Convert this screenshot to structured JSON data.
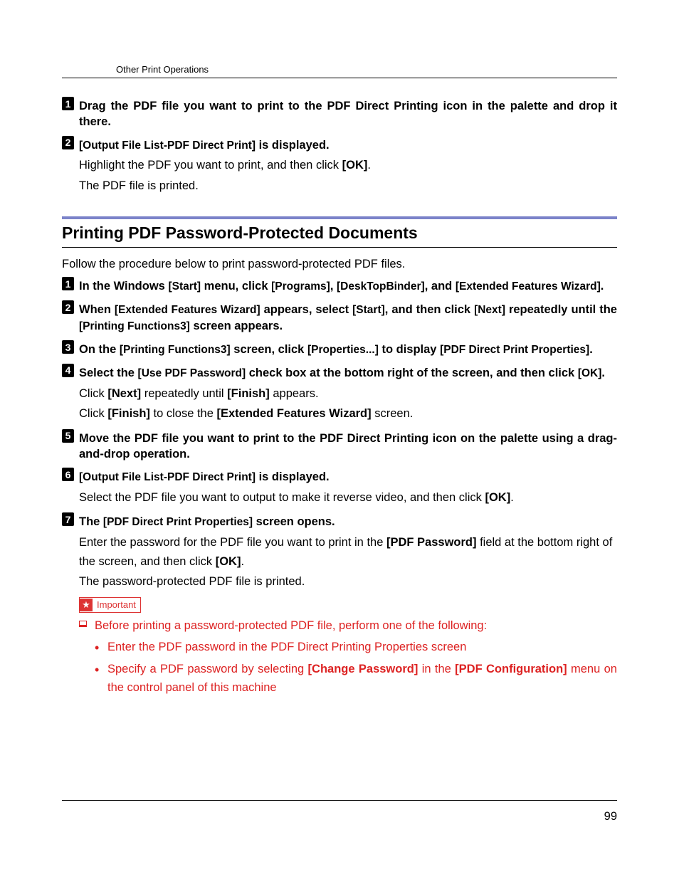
{
  "running_head": "Other Print Operations",
  "page_number": "99",
  "top_steps": {
    "s1": {
      "num": "1",
      "head": "Drag the PDF file you want to print to the PDF Direct Printing icon in the palette and drop it there."
    },
    "s2": {
      "num": "2",
      "head_pre": "[Output File List-PDF Direct Print]",
      "head_post": " is displayed.",
      "body_l1a": "Highlight the PDF you want to print, and then click ",
      "body_l1b": "[OK]",
      "body_l1c": ".",
      "body_l2": "The PDF file is printed."
    }
  },
  "section_title": "Printing PDF Password-Protected Documents",
  "intro": "Follow the procedure below to print password-protected PDF files.",
  "steps": {
    "s1": {
      "num": "1",
      "p1": "In the Windows ",
      "b1": "[Start]",
      "p2": " menu, click ",
      "b2": "[Programs]",
      "p3": ", ",
      "b3": "[DeskTopBinder]",
      "p4": ", and ",
      "b4": "[Extended Features Wizard]",
      "p5": "."
    },
    "s2": {
      "num": "2",
      "p1": "When ",
      "b1": "[Extended Features Wizard]",
      "p2": " appears, select ",
      "b2": "[Start]",
      "p3": ", and then click ",
      "b3": "[Next]",
      "p4": " repeatedly until the ",
      "b4": "[Printing Functions3]",
      "p5": " screen appears."
    },
    "s3": {
      "num": "3",
      "p1": "On the ",
      "b1": "[Printing Functions3]",
      "p2": " screen, click ",
      "b2": "[Properties...]",
      "p3": " to display ",
      "b3": "[PDF Direct Print Properties]",
      "p4": "."
    },
    "s4": {
      "num": "4",
      "p1": "Select the ",
      "b1": "[Use PDF Password]",
      "p2": " check box at the bottom right of the screen, and then click ",
      "b2": "[OK]",
      "p3": ".",
      "body_l1a": "Click ",
      "body_l1b": "[Next]",
      "body_l1c": " repeatedly until ",
      "body_l1d": "[Finish]",
      "body_l1e": " appears.",
      "body_l2a": "Click ",
      "body_l2b": "[Finish]",
      "body_l2c": " to close the ",
      "body_l2d": "[Extended Features Wizard]",
      "body_l2e": " screen."
    },
    "s5": {
      "num": "5",
      "head": "Move the PDF file you want to print to the PDF Direct Printing icon on the palette using a drag-and-drop operation."
    },
    "s6": {
      "num": "6",
      "b1": "[Output File List-PDF Direct Print]",
      "p1": " is displayed.",
      "body_a": "Select the PDF file you want to output to make it reverse video, and then click ",
      "body_b": "[OK]",
      "body_c": "."
    },
    "s7": {
      "num": "7",
      "p1": "The ",
      "b1": "[PDF Direct Print Properties]",
      "p2": " screen opens.",
      "body_l1a": "Enter the password for the PDF file you want to print in the ",
      "body_l1b": "[PDF Password]",
      "body_l1c": " field at the bottom right of the screen, and then click ",
      "body_l1d": "[OK]",
      "body_l1e": ".",
      "body_l2": "The password-protected PDF file is printed."
    }
  },
  "important": {
    "label": "Important",
    "lead": "Before printing a password-protected PDF file, perform one of the following:",
    "bullet1": "Enter the PDF password in the PDF Direct Printing Properties screen",
    "bullet2a": "Specify a PDF password by selecting ",
    "bullet2b": "[Change Password]",
    "bullet2c": " in the ",
    "bullet2d": "[PDF Configuration]",
    "bullet2e": " menu on the control panel of this machine"
  }
}
